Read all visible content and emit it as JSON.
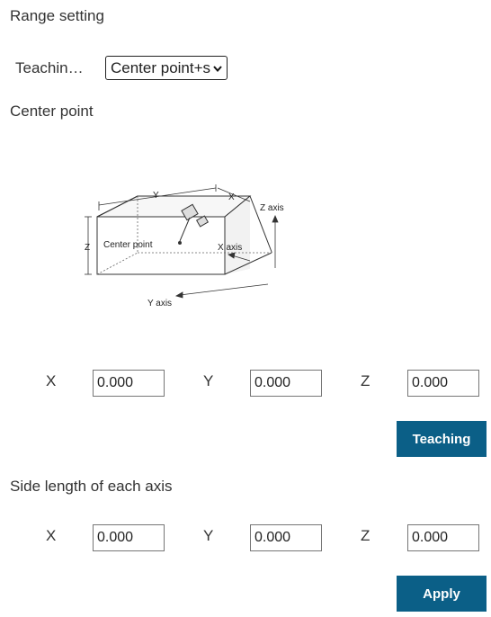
{
  "section_title": "Range setting",
  "teaching_mode": {
    "label": "Teachin…",
    "selected": "Center point+s"
  },
  "center_point": {
    "heading": "Center point",
    "diagram": {
      "y_dim": "Y",
      "x_dim": "X",
      "z_dim": "Z",
      "z_axis": "Z axis",
      "x_axis": "X axis",
      "y_axis": "Y axis",
      "center": "Center point"
    },
    "x_label": "X",
    "x_value": "0.000",
    "y_label": "Y",
    "y_value": "0.000",
    "z_label": "Z",
    "z_value": "0.000",
    "teaching_button": "Teaching"
  },
  "side_length": {
    "heading": "Side length of each axis",
    "x_label": "X",
    "x_value": "0.000",
    "y_label": "Y",
    "y_value": "0.000",
    "z_label": "Z",
    "z_value": "0.000",
    "apply_button": "Apply"
  }
}
